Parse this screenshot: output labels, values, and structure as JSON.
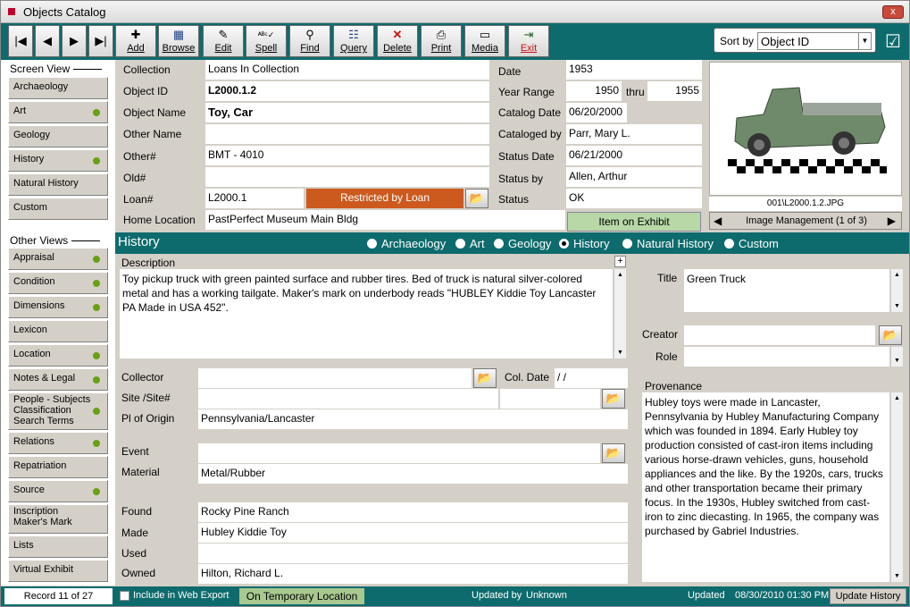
{
  "window": {
    "title": "Objects Catalog",
    "close": "x"
  },
  "toolbar": {
    "nav": [
      "|◀",
      "◀",
      "▶",
      "▶|"
    ],
    "buttons": [
      {
        "id": "add",
        "label": "Add",
        "icon": "✚"
      },
      {
        "id": "browse",
        "label": "Browse",
        "icon": "▦"
      },
      {
        "id": "edit",
        "label": "Edit",
        "icon": "✎"
      },
      {
        "id": "spell",
        "label": "Spell",
        "icon": "ᴬᴮᶜ✓"
      },
      {
        "id": "find",
        "label": "Find",
        "icon": "⚲"
      },
      {
        "id": "query",
        "label": "Query",
        "icon": "☷"
      },
      {
        "id": "delete",
        "label": "Delete",
        "icon": "✕"
      },
      {
        "id": "print",
        "label": "Print",
        "icon": "⎙"
      },
      {
        "id": "media",
        "label": "Media",
        "icon": "▭"
      },
      {
        "id": "exit",
        "label": "Exit",
        "icon": "⇥"
      }
    ],
    "sort_label": "Sort by",
    "sort_value": "Object ID"
  },
  "sidebar": {
    "screen_view": "Screen View",
    "screen_items": [
      {
        "label": "Archaeology",
        "dot": false
      },
      {
        "label": "Art",
        "dot": true
      },
      {
        "label": "Geology",
        "dot": false
      },
      {
        "label": "History",
        "dot": true
      },
      {
        "label": "Natural History",
        "dot": false
      },
      {
        "label": "Custom",
        "dot": false
      }
    ],
    "other_views": "Other Views",
    "other_items": [
      {
        "label": "Appraisal",
        "dot": true
      },
      {
        "label": "Condition",
        "dot": true
      },
      {
        "label": "Dimensions",
        "dot": true
      },
      {
        "label": "Lexicon",
        "dot": false
      },
      {
        "label": "Location",
        "dot": true
      },
      {
        "label": "Notes & Legal",
        "dot": true
      },
      {
        "label": "People - Subjects\nClassification\nSearch Terms",
        "dot": true
      },
      {
        "label": "Relations",
        "dot": true
      },
      {
        "label": "Repatriation",
        "dot": false
      },
      {
        "label": "Source",
        "dot": true
      },
      {
        "label": "Inscription\nMaker's Mark",
        "dot": false
      },
      {
        "label": "Lists",
        "dot": false
      },
      {
        "label": "Virtual Exhibit",
        "dot": false
      }
    ]
  },
  "record": {
    "collection_label": "Collection",
    "collection": "Loans In Collection",
    "object_id_label": "Object ID",
    "object_id": "L2000.1.2",
    "object_name_label": "Object Name",
    "object_name": "Toy, Car",
    "other_name_label": "Other Name",
    "other_name": "",
    "other_num_label": "Other#",
    "other_num": "BMT - 4010",
    "old_num_label": "Old#",
    "old_num": "",
    "loan_num_label": "Loan#",
    "loan_num": "L2000.1",
    "restricted": "Restricted by Loan",
    "home_location_label": "Home Location",
    "home_location": "PastPerfect Museum Main Bldg",
    "date_label": "Date",
    "date": "1953",
    "year_range_label": "Year Range",
    "year_from": "1950",
    "thru": "thru",
    "year_to": "1955",
    "catalog_date_label": "Catalog Date",
    "catalog_date": "06/20/2000",
    "cataloged_by_label": "Cataloged by",
    "cataloged_by": "Parr, Mary L.",
    "status_date_label": "Status Date",
    "status_date": "06/21/2000",
    "status_by_label": "Status by",
    "status_by": "Allen, Arthur",
    "status_label": "Status",
    "status": "OK",
    "exhibit": "Item on Exhibit"
  },
  "image": {
    "filename": "001\\L2000.1.2.JPG",
    "mgmt": "Image Management (1 of 3)"
  },
  "section": {
    "title": "History",
    "radios": [
      {
        "label": "Archaeology",
        "on": false
      },
      {
        "label": "Art",
        "on": false
      },
      {
        "label": "Geology",
        "on": false
      },
      {
        "label": "History",
        "on": true
      },
      {
        "label": "Natural History",
        "on": false
      },
      {
        "label": "Custom",
        "on": false
      }
    ]
  },
  "history": {
    "description_label": "Description",
    "description": "Toy pickup truck with green painted surface and rubber tires.  Bed of truck is natural silver-colored metal and has a working tailgate.  Maker's mark on underbody reads \"HUBLEY Kiddie Toy Lancaster PA Made in USA 452\".",
    "collector_label": "Collector",
    "collector": "",
    "col_date_label": "Col. Date",
    "col_date": "/  /",
    "site_label": "Site /Site#",
    "site": "",
    "origin_label": "Pl of Origin",
    "origin": "Pennsylvania/Lancaster",
    "event_label": "Event",
    "event": "",
    "material_label": "Material",
    "material": "Metal/Rubber",
    "found_label": "Found",
    "found": "Rocky Pine Ranch",
    "made_label": "Made",
    "made": "Hubley Kiddie Toy",
    "used_label": "Used",
    "used": "",
    "owned_label": "Owned",
    "owned": "Hilton, Richard L.",
    "title_label": "Title",
    "title": "Green Truck",
    "creator_label": "Creator",
    "creator": "",
    "role_label": "Role",
    "role": "",
    "provenance_label": "Provenance",
    "provenance": "Hubley toys were made in Lancaster, Pennsylvania by Hubley Manufacturing Company which was founded in 1894. Early Hubley toy production consisted of cast-iron items including various horse-drawn vehicles, guns, household appliances and the like. By the 1920s, cars, trucks and other transportation became their primary focus. In the 1930s, Hubley switched from cast-iron to zinc diecasting. In 1965, the company was purchased by Gabriel Industries."
  },
  "statusbar": {
    "record": "Record 11 of 27",
    "web_export": "Include in Web Export",
    "temp_location": "On Temporary Location",
    "updated_by_label": "Updated by",
    "updated_by": "Unknown",
    "updated_label": "Updated",
    "updated": "08/30/2010 01:30 PM",
    "update_history": "Update History"
  },
  "colors": {
    "teal": "#0e6b6d",
    "green_dot": "#6aa016",
    "restricted": "#cc5a1e",
    "exhibit": "#b8d8a8",
    "temp": "#a8c890"
  }
}
